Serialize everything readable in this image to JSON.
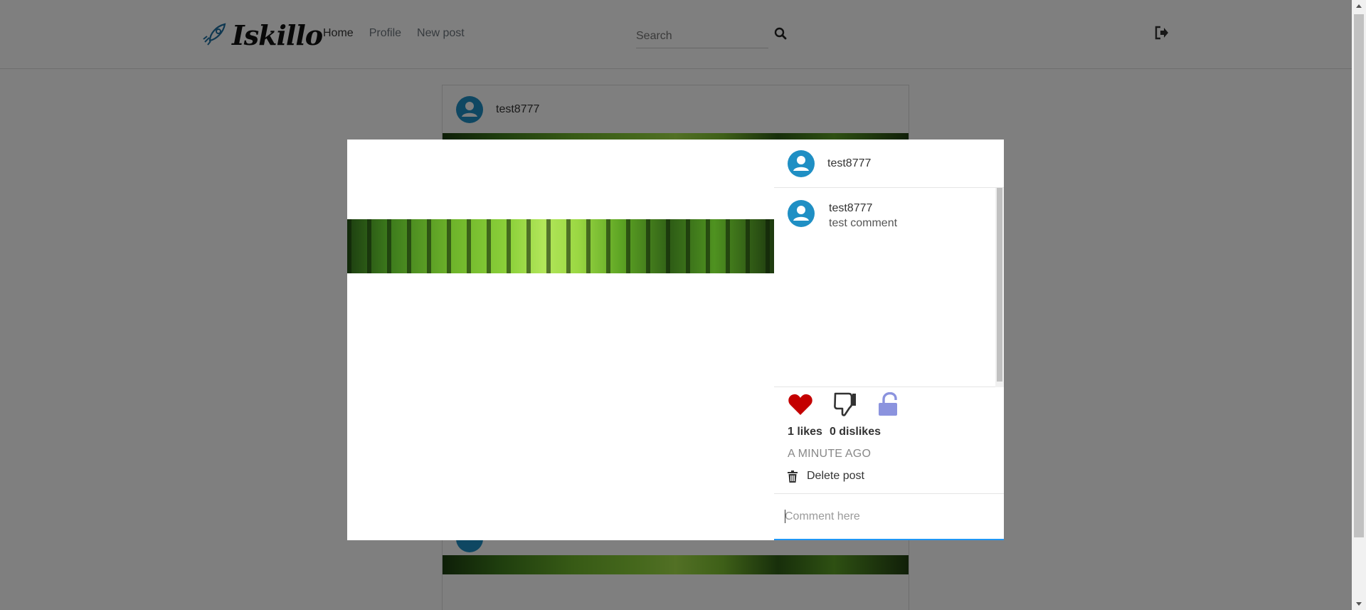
{
  "app": {
    "logo_text": "Iskillo"
  },
  "nav": {
    "links": [
      "Home",
      "Profile",
      "New post"
    ]
  },
  "search": {
    "placeholder": "Search"
  },
  "feed": {
    "post_author": "test8777"
  },
  "modal": {
    "author": "test8777",
    "comments": [
      {
        "user": "test8777",
        "text": "test comment"
      }
    ],
    "likes_label": "1 likes",
    "dislikes_label": "0 dislikes",
    "time_label": "A MINUTE AGO",
    "delete_label": "Delete post",
    "comment_placeholder": "Comment here"
  },
  "colors": {
    "like_active": "#c40000",
    "dislike": "#333333",
    "lock": "#8b93de",
    "avatar": "#1f8fc4",
    "input_focus": "#2196f3"
  },
  "icons": {
    "logo": "rocket-icon",
    "search": "search-icon",
    "logout": "logout-icon",
    "like": "heart-icon",
    "dislike": "thumbs-down-icon",
    "privacy": "unlock-icon",
    "delete": "trash-icon"
  }
}
